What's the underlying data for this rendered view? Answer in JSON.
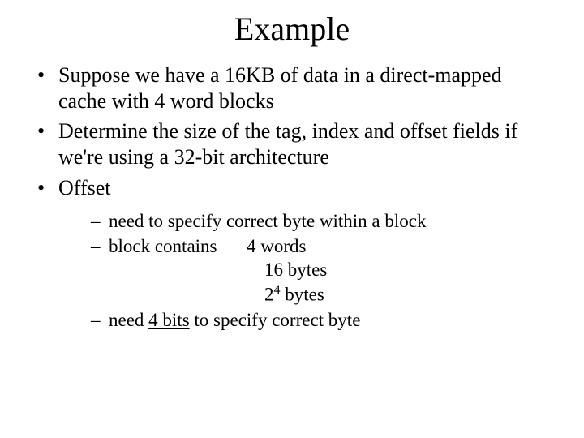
{
  "title": "Example",
  "bullets": {
    "b1": "Suppose we have a 16KB of data in a direct-mapped cache with 4 word blocks",
    "b2": "Determine the size of the tag, index and offset fields if we're using a 32-bit architecture",
    "b3": "Offset"
  },
  "sub": {
    "s1": "need to specify correct byte within a block",
    "s2_label": "block contains",
    "s2_v1": "4 words",
    "s2_v2": "16 bytes",
    "s2_v3a": "2",
    "s2_v3b": "4",
    "s2_v3c": " bytes",
    "s3a": "need ",
    "s3b": "4 bits",
    "s3c": " to specify correct byte"
  }
}
